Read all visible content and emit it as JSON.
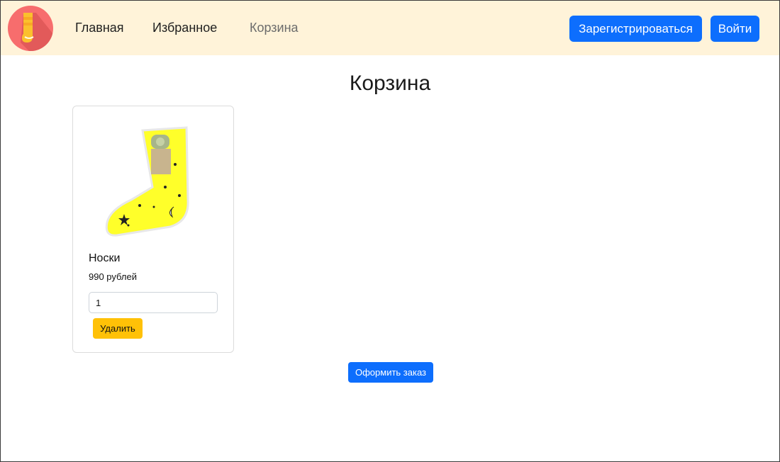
{
  "nav": {
    "logo_icon": "sock-logo-icon",
    "links": [
      {
        "label": "Главная"
      },
      {
        "label": "Избранное"
      },
      {
        "label": "Корзина"
      }
    ],
    "register_label": "Зарегистрироваться",
    "login_label": "Войти"
  },
  "main": {
    "title": "Корзина",
    "cart": {
      "items": [
        {
          "image_icon": "yellow-sock-image",
          "name": "Носки",
          "price": "990 рублей",
          "quantity": "1",
          "delete_label": "Удалить"
        }
      ]
    },
    "checkout_label": "Оформить заказ"
  },
  "colors": {
    "navbar_bg": "#fff3d9",
    "primary": "#0d6efd",
    "warning": "#ffc107",
    "logo_bg": "#f76d6d"
  }
}
